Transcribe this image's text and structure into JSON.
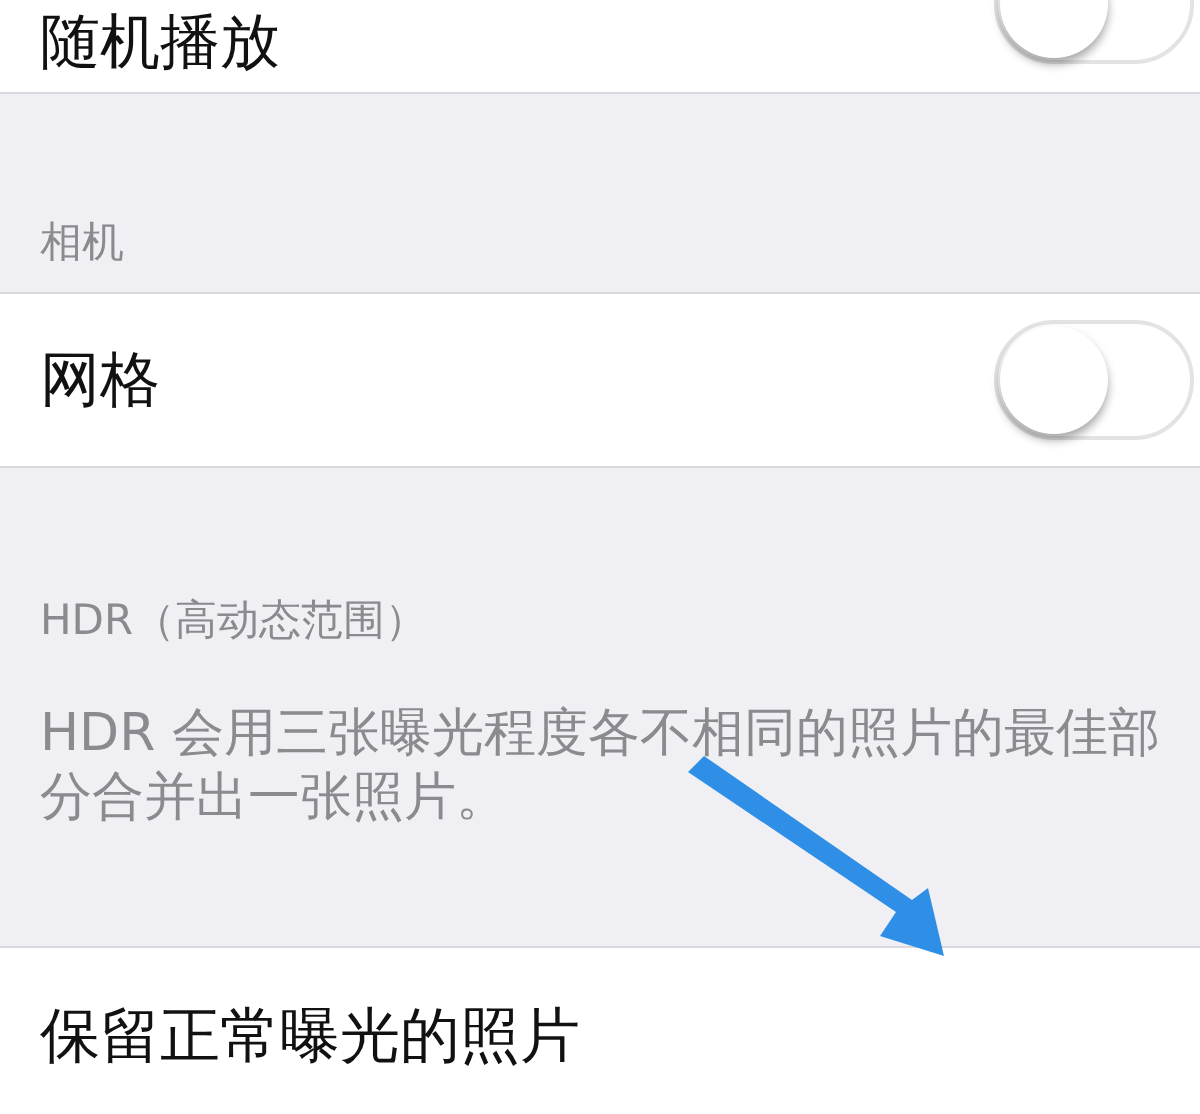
{
  "items": [
    {
      "kind": "toggle-row",
      "label": "随机播放",
      "on": false
    },
    {
      "kind": "header",
      "text": "相机"
    },
    {
      "kind": "toggle-row",
      "label": "网格",
      "on": false
    },
    {
      "kind": "header",
      "text": "HDR（高动态范围）"
    },
    {
      "kind": "note",
      "text": "HDR 会用三张曝光程度各不相同的照片的最佳部分合并出一张照片。"
    },
    {
      "kind": "plain-row",
      "label": "保留正常曝光的照片"
    }
  ]
}
